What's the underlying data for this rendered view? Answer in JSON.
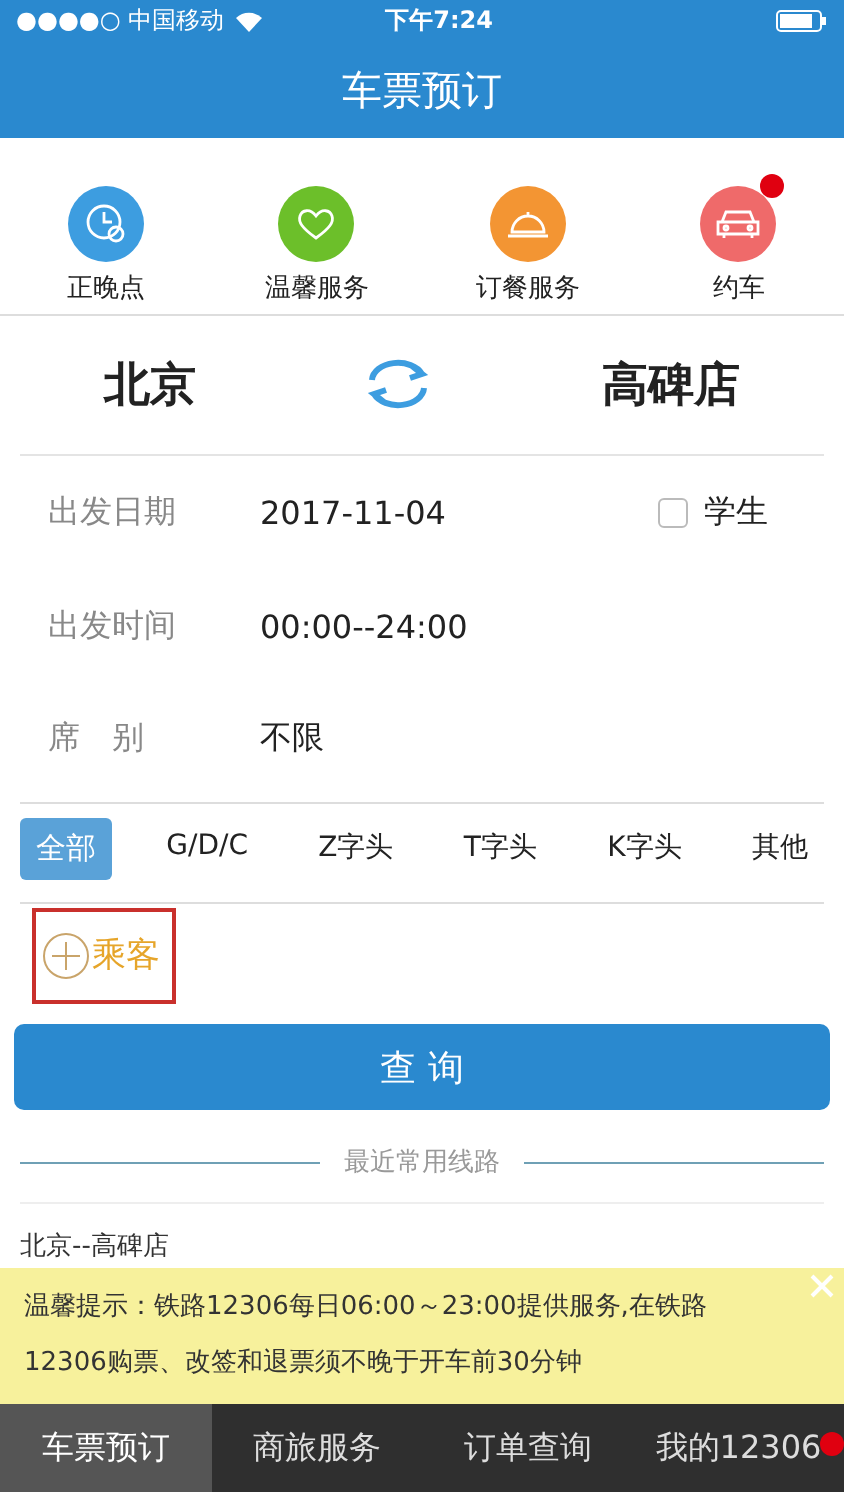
{
  "status_bar": {
    "carrier": "●●●●○ 中国移动",
    "time": "下午7:24"
  },
  "header": {
    "title": "车票预订"
  },
  "shortcuts": [
    {
      "label": "正晚点",
      "kind": "clock",
      "color": "#3d9de0",
      "badge": false
    },
    {
      "label": "温馨服务",
      "kind": "heart",
      "color": "#6cbf2a",
      "badge": false
    },
    {
      "label": "订餐服务",
      "kind": "meal",
      "color": "#f39533",
      "badge": false
    },
    {
      "label": "约车",
      "kind": "car",
      "color": "#ef6a6a",
      "badge": true
    }
  ],
  "route": {
    "from": "北京",
    "to": "高碑店"
  },
  "form": [
    {
      "label": "出发日期",
      "value": "2017-11-04"
    },
    {
      "label": "出发时间",
      "value": "00:00--24:00"
    },
    {
      "label": "席　别",
      "value": "不限"
    }
  ],
  "student": {
    "label": "学生",
    "checked": false
  },
  "train_types": [
    {
      "label": "全部",
      "selected": true
    },
    {
      "label": "G/D/C",
      "selected": false
    },
    {
      "label": "Z字头",
      "selected": false
    },
    {
      "label": "T字头",
      "selected": false
    },
    {
      "label": "K字头",
      "selected": false
    },
    {
      "label": "其他",
      "selected": false
    }
  ],
  "passenger": {
    "label": "乘客",
    "highlighted": true
  },
  "search_button": "查 询",
  "recent": {
    "heading": "最近常用线路",
    "routes": [
      "北京--高碑店"
    ]
  },
  "notice": {
    "text": "温馨提示：铁路12306每日06:00～23:00提供服务,在铁路12306购票、改签和退票须不晚于开车前30分钟"
  },
  "tab_bar": [
    {
      "label": "车票预订",
      "selected": true,
      "badge": false
    },
    {
      "label": "商旅服务",
      "selected": false,
      "badge": false
    },
    {
      "label": "订单查询",
      "selected": false,
      "badge": false
    },
    {
      "label": "我的12306",
      "selected": false,
      "badge": true
    }
  ]
}
